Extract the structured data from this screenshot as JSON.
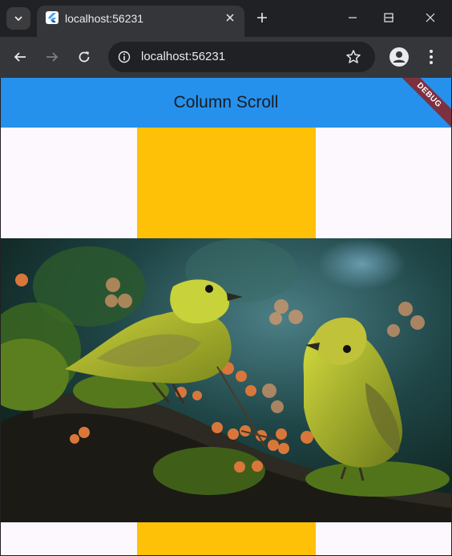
{
  "browser": {
    "tab_title": "localhost:56231",
    "address": "localhost:56231",
    "icons": {
      "tab_search": "chevron-down-icon",
      "favicon": "flutter-logo-icon",
      "tab_close": "close-icon",
      "new_tab": "plus-icon",
      "minimize": "minimize-icon",
      "maximize": "maximize-icon",
      "close_window": "close-icon",
      "back": "arrow-left-icon",
      "forward": "arrow-right-icon",
      "reload": "reload-icon",
      "site_info": "info-icon",
      "bookmark": "star-icon",
      "profile": "person-icon",
      "menu": "more-vert-icon"
    }
  },
  "app": {
    "title": "Column Scroll",
    "debug_banner": "DEBUG",
    "colors": {
      "appbar": "#2591ed",
      "background": "#fdf7fe",
      "box": "#ffc107",
      "debug_banner": "#7d3140"
    }
  }
}
